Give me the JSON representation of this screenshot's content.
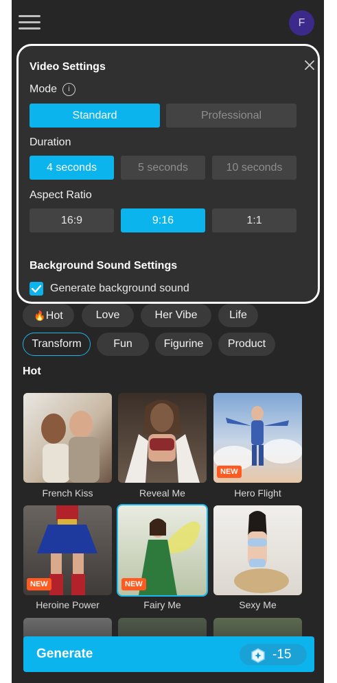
{
  "header": {
    "avatar_letter": "F"
  },
  "settings": {
    "title": "Video Settings",
    "mode_label": "Mode",
    "mode_options": [
      "Standard",
      "Professional"
    ],
    "duration_label": "Duration",
    "duration_options": [
      "4 seconds",
      "5 seconds",
      "10 seconds"
    ],
    "aspect_label": "Aspect Ratio",
    "aspect_options": [
      "16:9",
      "9:16",
      "1:1"
    ],
    "sound_title": "Background Sound Settings",
    "sound_checkbox_label": "Generate background sound"
  },
  "categories": [
    "Hot",
    "Love",
    "Her Vibe",
    "Life",
    "Transform",
    "Fun",
    "Figurine",
    "Product"
  ],
  "section_title": "Hot",
  "templates": [
    {
      "name": "French Kiss",
      "badge": ""
    },
    {
      "name": "Reveal Me",
      "badge": ""
    },
    {
      "name": "Hero Flight",
      "badge": "NEW"
    },
    {
      "name": "Heroine Power",
      "badge": "NEW"
    },
    {
      "name": "Fairy Me",
      "badge": "NEW"
    },
    {
      "name": "Sexy Me",
      "badge": ""
    }
  ],
  "generate": {
    "label": "Generate",
    "cost": "-15"
  },
  "colors": {
    "accent": "#0bb4ec",
    "badge": "#ff5a1f",
    "background": "#262626"
  }
}
